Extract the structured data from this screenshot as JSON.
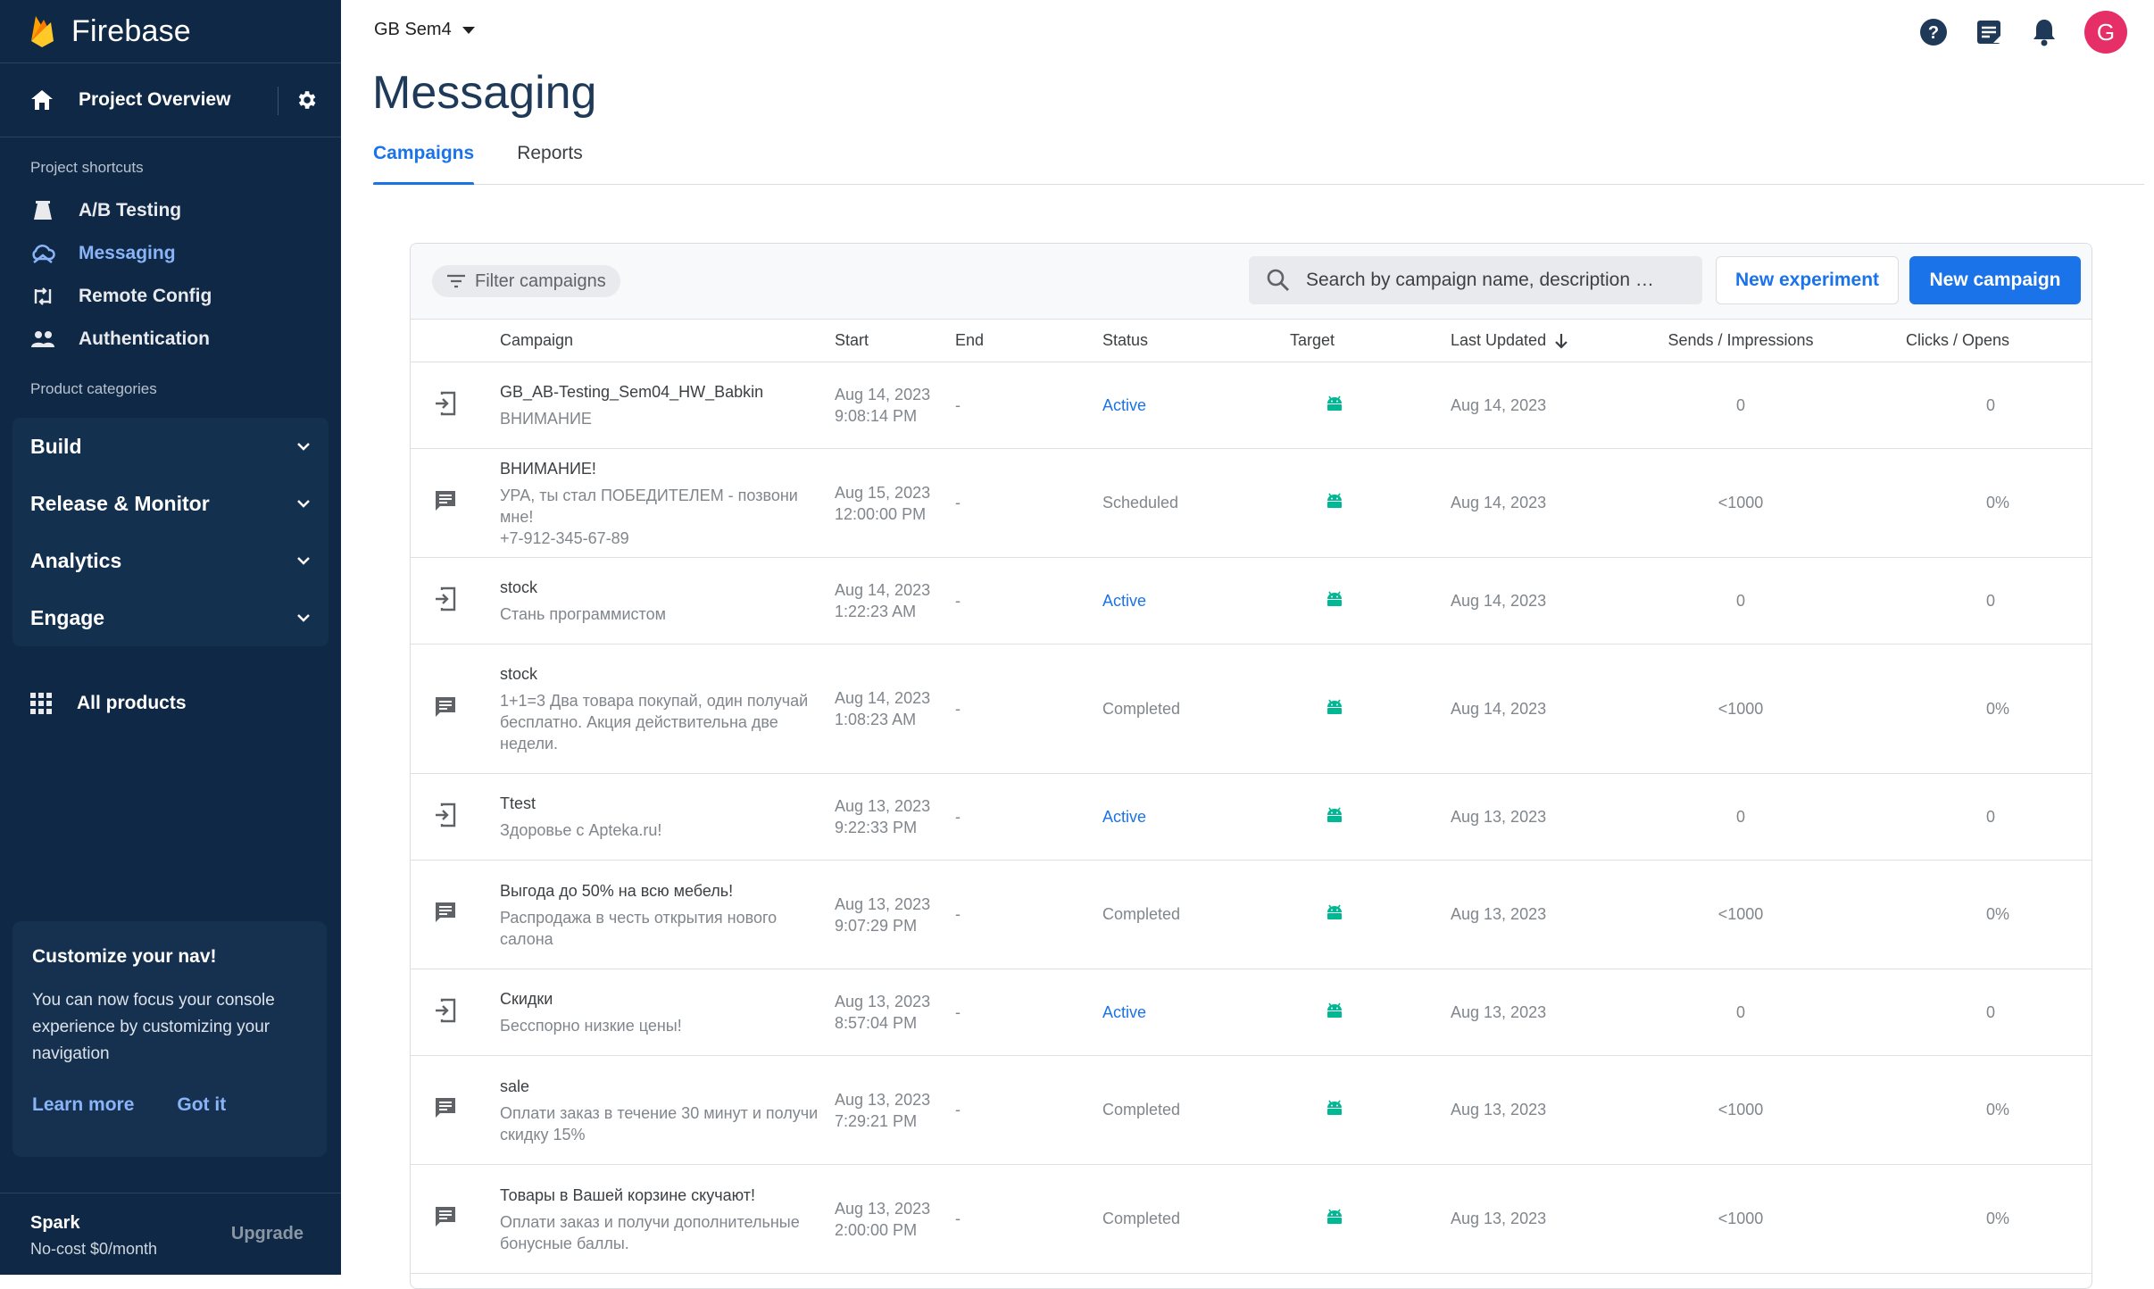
{
  "app": {
    "name": "Firebase"
  },
  "sidebar": {
    "overview_label": "Project Overview",
    "shortcuts_label": "Project shortcuts",
    "shortcuts": [
      {
        "label": "A/B Testing",
        "icon": "flask-icon"
      },
      {
        "label": "Messaging",
        "icon": "cloud-messaging-icon",
        "active": true
      },
      {
        "label": "Remote Config",
        "icon": "remote-config-icon"
      },
      {
        "label": "Authentication",
        "icon": "people-icon"
      }
    ],
    "categories_label": "Product categories",
    "categories": [
      "Build",
      "Release & Monitor",
      "Analytics",
      "Engage"
    ],
    "all_products": "All products",
    "promo": {
      "title": "Customize your nav!",
      "text": "You can now focus your console experience by customizing your navigation",
      "learn_more": "Learn more",
      "got_it": "Got it"
    },
    "plan": {
      "name": "Spark",
      "price": "No-cost $0/month",
      "upgrade": "Upgrade"
    }
  },
  "header": {
    "project": "GB Sem4",
    "avatar_letter": "G"
  },
  "page": {
    "title": "Messaging",
    "tabs": [
      "Campaigns",
      "Reports"
    ]
  },
  "toolbar": {
    "filter_label": "Filter campaigns",
    "search_placeholder": "Search by campaign name, description …",
    "new_experiment": "New experiment",
    "new_campaign": "New campaign"
  },
  "table": {
    "columns": [
      "Campaign",
      "Start",
      "End",
      "Status",
      "Target",
      "Last Updated",
      "Sends / Impressions",
      "Clicks / Opens"
    ],
    "rows": [
      {
        "type": "in-app",
        "name": "GB_AB-Testing_Sem04_HW_Babkin",
        "desc": [
          "ВНИМАНИЕ"
        ],
        "start_date": "Aug 14, 2023",
        "start_time": "9:08:14 PM",
        "end": "-",
        "status": "Active",
        "updated": "Aug 14, 2023",
        "sends": "0",
        "clicks": "0"
      },
      {
        "type": "notification",
        "name": "ВНИМАНИЕ!",
        "desc": [
          "УРА, ты стал ПОБЕДИТЕЛЕМ - позвони мне!",
          "+7-912-345-67-89"
        ],
        "start_date": "Aug 15, 2023",
        "start_time": "12:00:00 PM",
        "end": "-",
        "status": "Scheduled",
        "updated": "Aug 14, 2023",
        "sends": "<1000",
        "clicks": "0%"
      },
      {
        "type": "in-app",
        "name": "stock",
        "desc": [
          "Стань программистом"
        ],
        "start_date": "Aug 14, 2023",
        "start_time": "1:22:23 AM",
        "end": "-",
        "status": "Active",
        "updated": "Aug 14, 2023",
        "sends": "0",
        "clicks": "0"
      },
      {
        "type": "notification",
        "name": "stock",
        "desc": [
          "1+1=3 Два товара покупай, один получай",
          "бесплатно. Акция действительна две",
          "недели."
        ],
        "start_date": "Aug 14, 2023",
        "start_time": "1:08:23 AM",
        "end": "-",
        "status": "Completed",
        "updated": "Aug 14, 2023",
        "sends": "<1000",
        "clicks": "0%"
      },
      {
        "type": "in-app",
        "name": "Ttest",
        "desc": [
          "Здоровье с Apteka.ru!"
        ],
        "start_date": "Aug 13, 2023",
        "start_time": "9:22:33 PM",
        "end": "-",
        "status": "Active",
        "updated": "Aug 13, 2023",
        "sends": "0",
        "clicks": "0"
      },
      {
        "type": "notification",
        "name": "Выгода до 50% на всю мебель!",
        "desc": [
          "Распродажа в честь открытия нового",
          "салона"
        ],
        "start_date": "Aug 13, 2023",
        "start_time": "9:07:29 PM",
        "end": "-",
        "status": "Completed",
        "updated": "Aug 13, 2023",
        "sends": "<1000",
        "clicks": "0%"
      },
      {
        "type": "in-app",
        "name": "Скидки",
        "desc": [
          "Бесспорно низкие цены!"
        ],
        "start_date": "Aug 13, 2023",
        "start_time": "8:57:04 PM",
        "end": "-",
        "status": "Active",
        "updated": "Aug 13, 2023",
        "sends": "0",
        "clicks": "0"
      },
      {
        "type": "notification",
        "name": "sale",
        "desc": [
          "Оплати заказ в течение 30 минут и получи",
          "скидку 15%"
        ],
        "start_date": "Aug 13, 2023",
        "start_time": "7:29:21 PM",
        "end": "-",
        "status": "Completed",
        "updated": "Aug 13, 2023",
        "sends": "<1000",
        "clicks": "0%"
      },
      {
        "type": "notification",
        "name": "Товары в Вашей корзине скучают!",
        "desc": [
          "Оплати заказ и получи дополнительные",
          "бонусные баллы."
        ],
        "start_date": "Aug 13, 2023",
        "start_time": "2:00:00 PM",
        "end": "-",
        "status": "Completed",
        "updated": "Aug 13, 2023",
        "sends": "<1000",
        "clicks": "0%"
      }
    ]
  },
  "colors": {
    "sidebar_bg": "#0f2845",
    "accent": "#1a73e8",
    "android_green": "#00b894",
    "avatar": "#e52f66"
  }
}
